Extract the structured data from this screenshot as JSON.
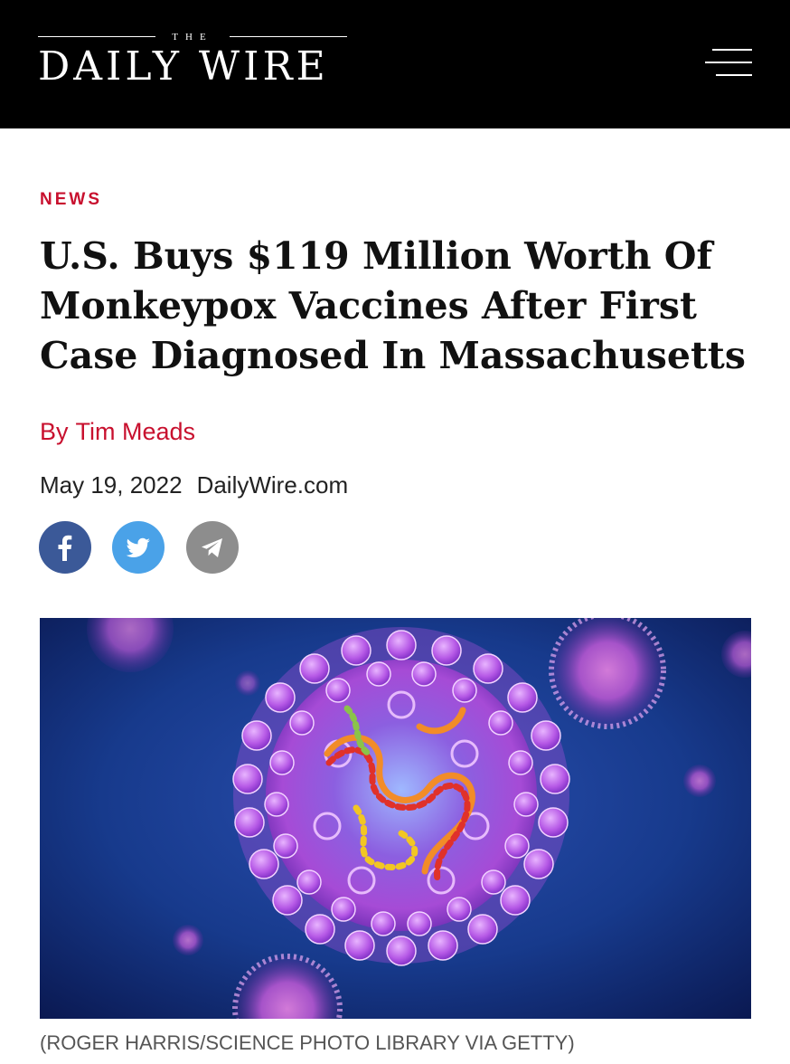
{
  "header": {
    "logo_small": "THE",
    "logo_main": "DAILY WIRE",
    "background": "#000000",
    "menu_icon": "hamburger-menu-icon"
  },
  "article": {
    "section": "NEWS",
    "headline": "U.S. Buys $119 Million Worth Of Monkeypox Vaccines After First Case Diagnosed In Massachusetts",
    "byline_prefix": "By",
    "author": "Tim Meads",
    "date": "May 19, 2022",
    "source": "DailyWire.com",
    "share": [
      {
        "network": "facebook",
        "icon": "facebook-icon",
        "color": "#3b5998"
      },
      {
        "network": "twitter",
        "icon": "twitter-icon",
        "color": "#4aa2e8"
      },
      {
        "network": "telegram",
        "icon": "telegram-icon",
        "color": "#8d8d8d"
      }
    ],
    "image_caption": "(ROGER HARRIS/SCIENCE PHOTO LIBRARY VIA GETTY)"
  },
  "colors": {
    "accent": "#c8102e",
    "headline": "#111111",
    "text": "#222222",
    "caption": "#555555"
  }
}
